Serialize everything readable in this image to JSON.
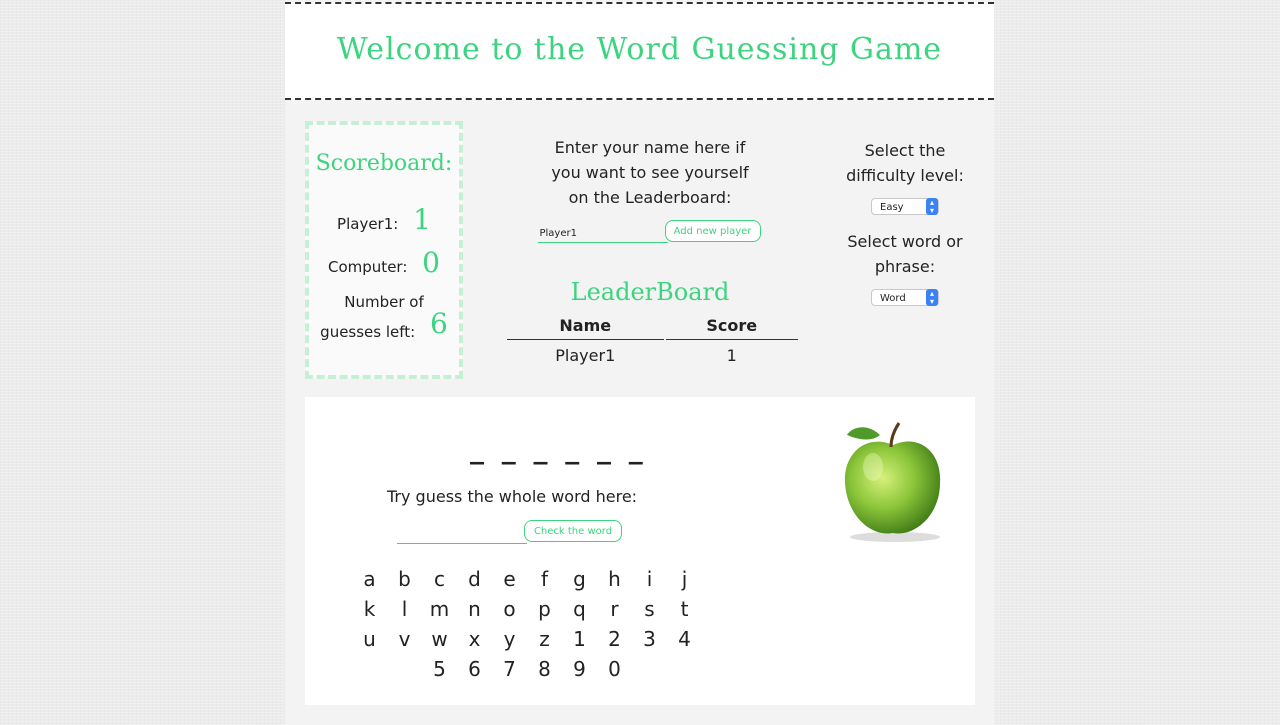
{
  "title": "Welcome to the Word Guessing Game",
  "scoreboard": {
    "title": "Scoreboard:",
    "player_label": "Player1:",
    "player_score": "1",
    "computer_label": "Computer:",
    "computer_score": "0",
    "guesses_label_1": "Number of",
    "guesses_label_2": "guesses left:",
    "guesses_left": "6"
  },
  "name_prompt": [
    "Enter your name here if",
    "you want to see yourself",
    "on the Leaderboard:"
  ],
  "name_input_value": "Player1",
  "add_player_label": "Add new player",
  "leaderboard": {
    "title": "LeaderBoard",
    "headers": [
      "Name",
      "Score"
    ],
    "rows": [
      [
        "Player1",
        "1"
      ]
    ]
  },
  "difficulty": {
    "label_1": "Select the",
    "label_2": "difficulty level:",
    "selected": "Easy"
  },
  "mode": {
    "label_1": "Select word or",
    "label_2": "phrase:",
    "selected": "Word"
  },
  "game": {
    "blanks": "_ _ _ _ _ _",
    "try_label": "Try guess the whole word here:",
    "check_label": "Check the word",
    "letters": [
      [
        "a",
        "b",
        "c",
        "d",
        "e",
        "f",
        "g",
        "h",
        "i",
        "j"
      ],
      [
        "k",
        "l",
        "m",
        "n",
        "o",
        "p",
        "q",
        "r",
        "s",
        "t"
      ],
      [
        "u",
        "v",
        "w",
        "x",
        "y",
        "z",
        "1",
        "2",
        "3",
        "4"
      ],
      [
        "",
        "",
        "5",
        "6",
        "7",
        "8",
        "9",
        "0"
      ]
    ]
  },
  "colors": {
    "accent": "#3dd47f",
    "select_arrow": "#3b82f6"
  },
  "icons": {
    "hint_image": "green-apple-icon"
  }
}
